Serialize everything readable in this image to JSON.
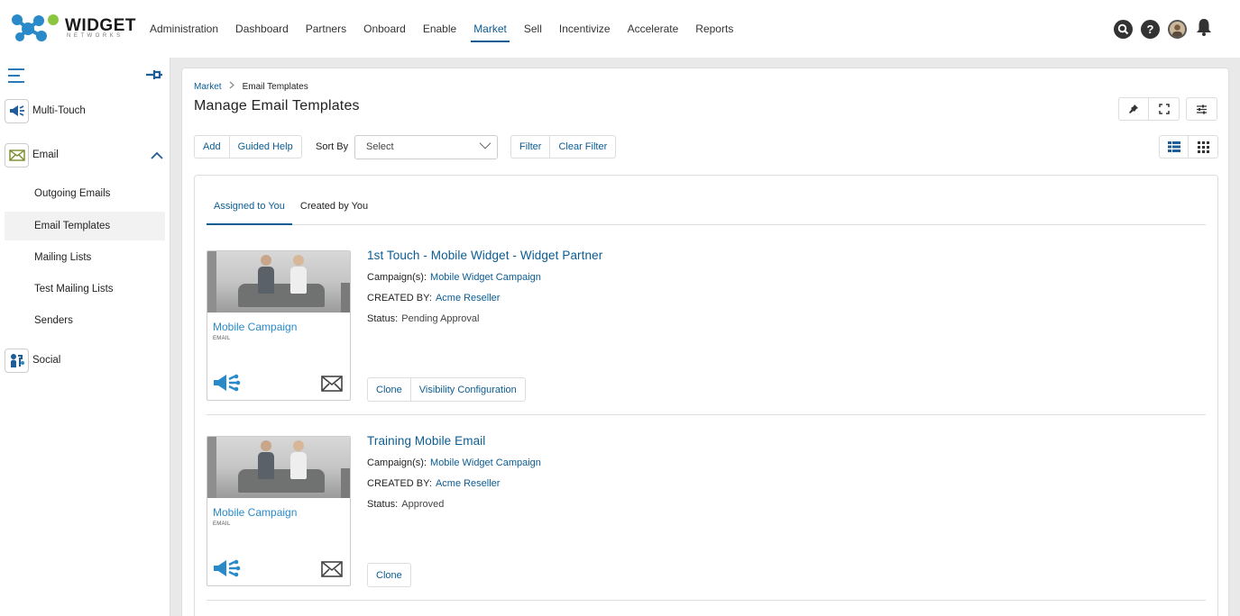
{
  "brand": {
    "name": "WIDGET",
    "tagline": "NETWORKS",
    "colors": {
      "blue": "#2a8ac9",
      "green": "#8cc63f",
      "link": "#0b5c93"
    }
  },
  "nav": {
    "items": [
      "Administration",
      "Dashboard",
      "Partners",
      "Onboard",
      "Enable",
      "Market",
      "Sell",
      "Incentivize",
      "Accelerate",
      "Reports"
    ],
    "active": "Market"
  },
  "top_icons": [
    "search-icon",
    "help-icon",
    "avatar",
    "bell-icon"
  ],
  "sidebar": {
    "sections": [
      {
        "label": "Multi-Touch",
        "icon": "megaphone-icon"
      },
      {
        "label": "Email",
        "icon": "envelope-icon",
        "expanded": true
      },
      {
        "label": "Social",
        "icon": "social-icon"
      }
    ],
    "email_items": [
      "Outgoing Emails",
      "Email Templates",
      "Mailing Lists",
      "Test Mailing Lists",
      "Senders"
    ],
    "active_item": "Email Templates"
  },
  "breadcrumb": {
    "parent": "Market",
    "current": "Email Templates"
  },
  "page": {
    "title": "Manage Email Templates"
  },
  "toolbar": {
    "add_label": "Add",
    "guided_help_label": "Guided Help",
    "sort_by_label": "Sort By",
    "sort_value": "Select",
    "filter_label": "Filter",
    "clear_filter_label": "Clear Filter"
  },
  "tabs": {
    "assigned": "Assigned to You",
    "created": "Created by You",
    "active": "Assigned to You"
  },
  "templates": [
    {
      "title": "1st Touch - Mobile Widget - Widget Partner",
      "campaigns_label": "Campaign(s):",
      "campaign": "Mobile Widget Campaign",
      "created_by_label": "CREATED BY:",
      "created_by": "Acme Reseller",
      "status_label": "Status:",
      "status": "Pending Approval",
      "thumb_caption": "Mobile Campaign",
      "thumb_sub": "EMAIL",
      "actions": [
        "Clone",
        "Visibility Configuration"
      ]
    },
    {
      "title": "Training Mobile Email",
      "campaigns_label": "Campaign(s):",
      "campaign": "Mobile Widget Campaign",
      "created_by_label": "CREATED BY:",
      "created_by": "Acme Reseller",
      "status_label": "Status:",
      "status": "Approved",
      "thumb_caption": "Mobile Campaign",
      "thumb_sub": "EMAIL",
      "actions": [
        "Clone"
      ]
    }
  ]
}
